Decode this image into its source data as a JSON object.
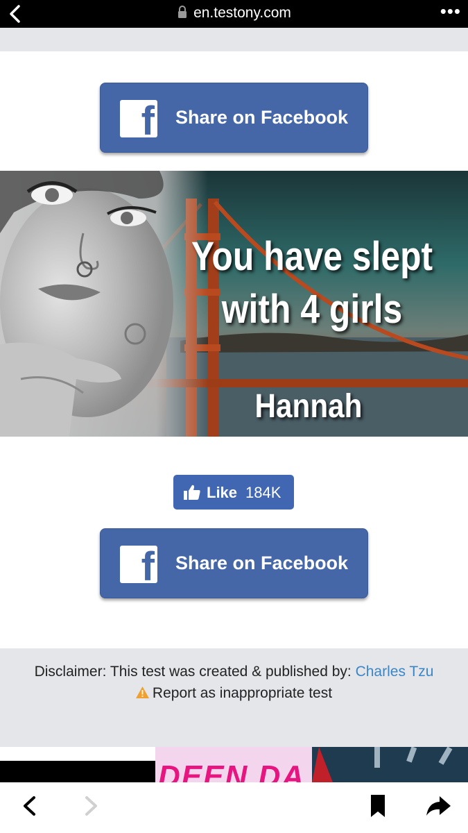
{
  "browser": {
    "url": "en.testony.com",
    "more_label": "•••"
  },
  "share": {
    "top_label": "Share on Facebook",
    "bottom_label": "Share on Facebook",
    "icon": "facebook-f-icon",
    "color": "#4567a8"
  },
  "result": {
    "headline_line1": "You have slept",
    "headline_line2": "with 4 girls",
    "name": "Hannah"
  },
  "like": {
    "label": "Like",
    "count": "184K",
    "icon": "thumbs-up-icon",
    "color": "#4267b2"
  },
  "disclaimer": {
    "prefix": "Disclaimer: This test was created & published by: ",
    "author": "Charles Tzu",
    "report_label": "Report as inappropriate test",
    "warning_icon": "warning-icon"
  },
  "ad": {
    "text": "DEEN DA"
  },
  "toolbar": {
    "back_icon": "chevron-left-icon",
    "forward_icon": "chevron-right-icon",
    "bookmark_icon": "bookmark-icon",
    "share_icon": "share-arrow-icon"
  }
}
